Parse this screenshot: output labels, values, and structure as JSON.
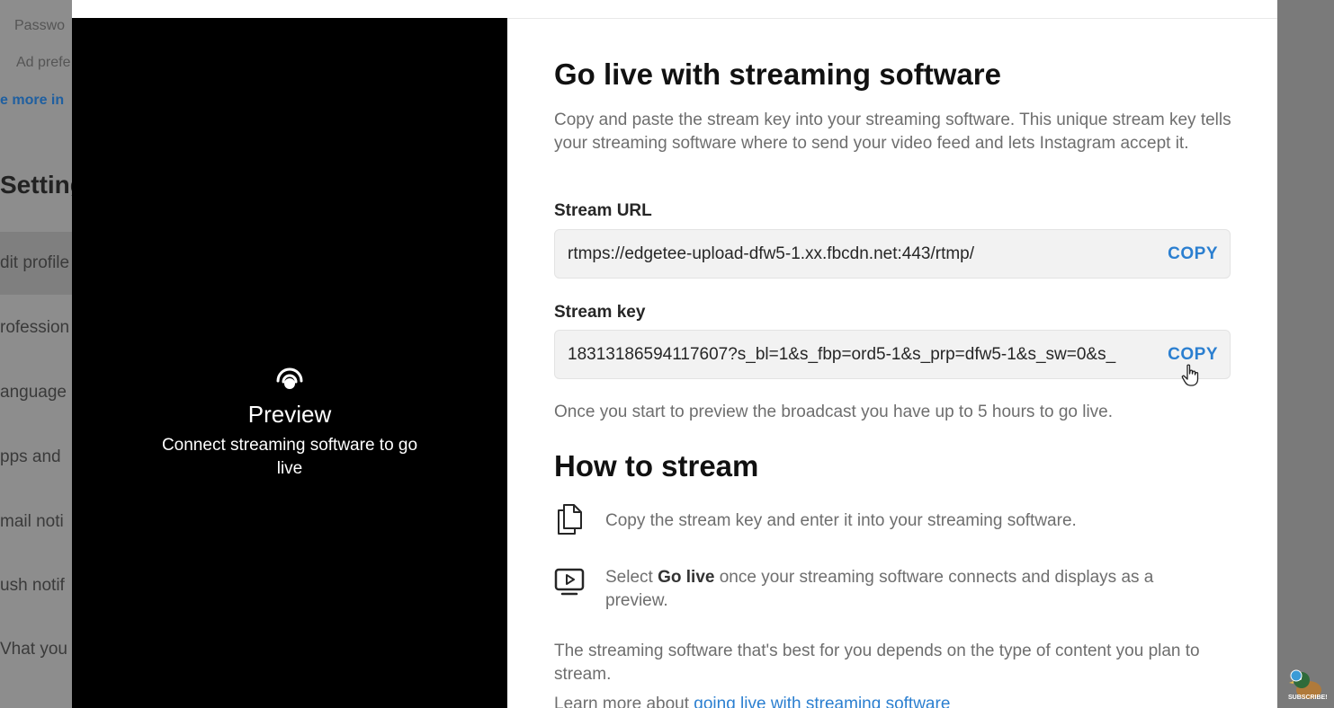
{
  "background": {
    "items": [
      "Passwo",
      "Ad prefe",
      "e more in",
      "Setting",
      "dit profile",
      "rofession",
      "anguage",
      "pps and",
      "mail noti",
      "ush notif",
      "Vhat you"
    ]
  },
  "preview": {
    "title": "Preview",
    "subtitle": "Connect streaming software to go live"
  },
  "main": {
    "title": "Go live with streaming software",
    "description": "Copy and paste the stream key into your streaming software. This unique stream key tells your streaming software where to send your video feed and lets Instagram accept it.",
    "stream_url": {
      "label": "Stream URL",
      "value": "rtmps://edgetee-upload-dfw5-1.xx.fbcdn.net:443/rtmp/",
      "copy_label": "COPY"
    },
    "stream_key": {
      "label": "Stream key",
      "value": "18313186594117607?s_bl=1&s_fbp=ord5-1&s_prp=dfw5-1&s_sw=0&s_",
      "copy_label": "COPY"
    },
    "note": "Once you start to preview the broadcast you have up to 5 hours to go live.",
    "how_title": "How to stream",
    "step1": "Copy the stream key and enter it into your streaming software.",
    "step2_prefix": "Select ",
    "step2_bold": "Go live",
    "step2_suffix": " once your streaming software connects and displays as a preview.",
    "tail": "The streaming software that's best for you depends on the type of content you plan to stream.",
    "learn_prefix": "Learn more about ",
    "learn_link": "going live with streaming software"
  },
  "branding": {
    "label": "SUBSCRIBE!"
  },
  "colors": {
    "accent": "#2b7fd0",
    "overlay": "#8a8a8a",
    "preview_bg": "#000000"
  }
}
